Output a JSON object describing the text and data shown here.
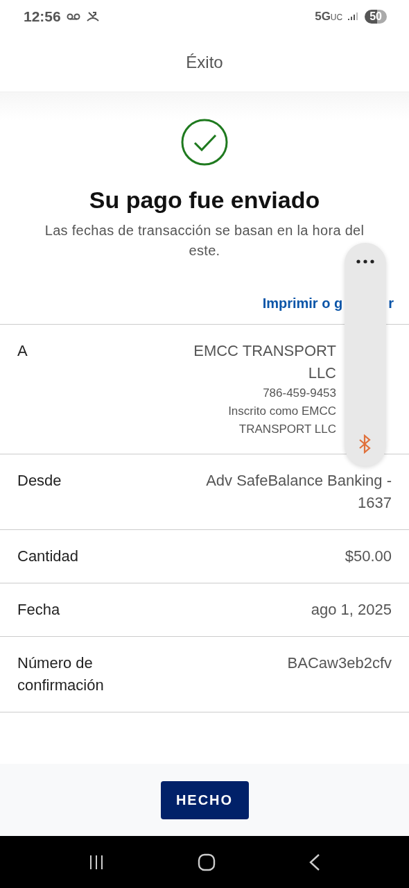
{
  "status_bar": {
    "time": "12:56",
    "network": "5G",
    "network_suffix": "UC",
    "battery": "50"
  },
  "header": {
    "title": "Éxito"
  },
  "success": {
    "heading": "Su pago fue enviado",
    "note": "Las fechas de transacción se basan en la hora del este."
  },
  "print_link": {
    "start": "Imprimir o g",
    "end": "r"
  },
  "details": [
    {
      "label": "A",
      "value": "EMCC TRANSPORT LLC",
      "extra": [
        "786-459-9453",
        "Inscrito como EMCC TRANSPORT LLC"
      ]
    },
    {
      "label": "Desde",
      "value": "Adv SafeBalance Banking - 1637"
    },
    {
      "label": "Cantidad",
      "value": "$50.00"
    },
    {
      "label": "Fecha",
      "value": "ago 1, 2025"
    },
    {
      "label": "Número de confirmación",
      "value": "BACaw3eb2cfv"
    }
  ],
  "done_button": "HECHO"
}
